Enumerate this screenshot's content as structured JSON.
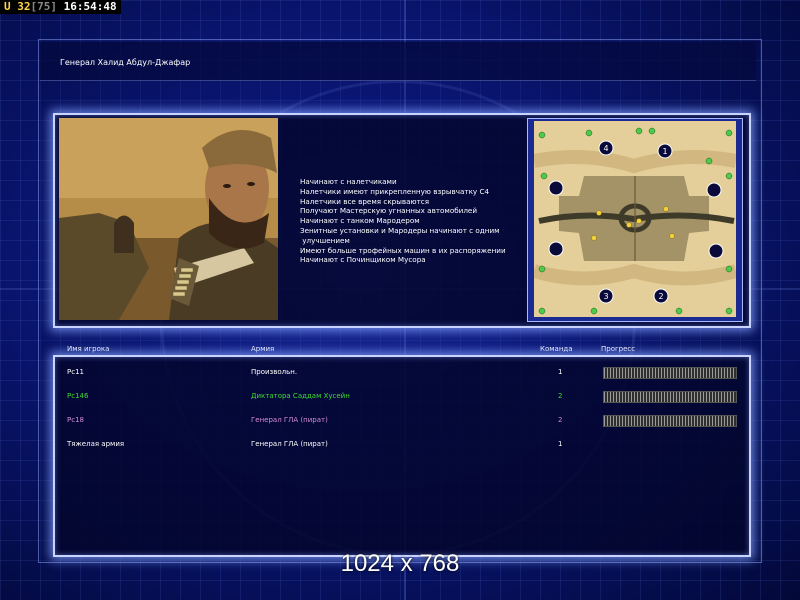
{
  "hud": {
    "prefix": "U",
    "units": "32",
    "limit": "[75]",
    "time": "16:54:48"
  },
  "general": {
    "name": "Генерал Халид Абдул-Джафар"
  },
  "features": [
    "Начинают с налетчиками",
    "Налетчики имеют прикрепленную взрывчатку C4",
    "Налетчики все время скрываются",
    "Получают Мастерскую угнанных автомобилей",
    "Начинают с танком Мародером",
    "Зенитные установки и Мародеры начинают с одним",
    " улучшением",
    "Имеют больше трофейных машин в их распоряжении",
    "Начинают с Починщиком Мусора"
  ],
  "map": {
    "slots": [
      "4",
      "1",
      "3",
      "2"
    ]
  },
  "columns": {
    "player": "Имя игрока",
    "army": "Армия",
    "team": "Команда",
    "progress": "Прогресс"
  },
  "players": [
    {
      "name": "Pc11",
      "army": "Произвольн.",
      "team": "1",
      "color": "#ffffff",
      "progress": 1.0
    },
    {
      "name": "Pc146",
      "army": "Диктатора Саддам Хусейн",
      "team": "2",
      "color": "#3bdc2e",
      "progress": 1.0
    },
    {
      "name": "Pc18",
      "army": "Генерал ГЛА (пират)",
      "team": "2",
      "color": "#d58ad6",
      "progress": 1.0
    },
    {
      "name": "Тяжелая армия",
      "army": "Генерал ГЛА (пират)",
      "team": "1",
      "color": "#ffffff",
      "progress": null
    }
  ],
  "resolution": "1024 x 768",
  "colors": {
    "frame_glow": "#c8d4ff",
    "background": "#0d1a85",
    "sand": "#e4cf9a"
  }
}
